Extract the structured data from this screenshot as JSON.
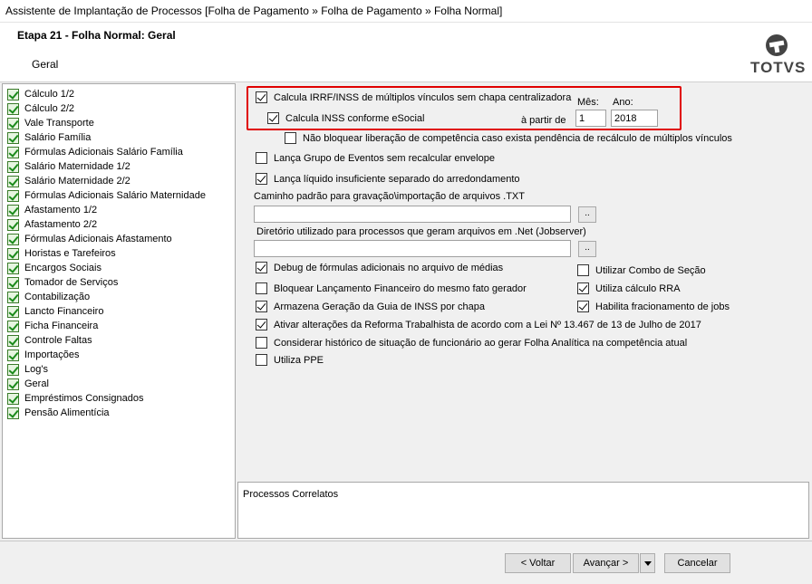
{
  "window": {
    "title": "Assistente de Implantação de Processos [Folha de Pagamento » Folha de Pagamento » Folha Normal]"
  },
  "header": {
    "step_title": "Etapa 21 - Folha Normal: Geral",
    "subtitle": "Geral",
    "logo_text": "TOTVS"
  },
  "sidebar": {
    "items": [
      {
        "label": "Cálculo 1/2"
      },
      {
        "label": "Cálculo 2/2"
      },
      {
        "label": "Vale Transporte"
      },
      {
        "label": "Salário Família"
      },
      {
        "label": "Fórmulas Adicionais Salário Família"
      },
      {
        "label": "Salário Maternidade 1/2"
      },
      {
        "label": "Salário Maternidade 2/2"
      },
      {
        "label": "Fórmulas Adicionais Salário Maternidade"
      },
      {
        "label": "Afastamento 1/2"
      },
      {
        "label": "Afastamento 2/2"
      },
      {
        "label": "Fórmulas Adicionais Afastamento"
      },
      {
        "label": "Horistas e Tarefeiros"
      },
      {
        "label": "Encargos Sociais"
      },
      {
        "label": "Tomador de Serviços"
      },
      {
        "label": "Contabilização"
      },
      {
        "label": "Lancto Financeiro"
      },
      {
        "label": "Ficha Financeira"
      },
      {
        "label": "Controle Faltas"
      },
      {
        "label": "Importações"
      },
      {
        "label": "Log's"
      },
      {
        "label": "Geral"
      },
      {
        "label": "Empréstimos Consignados"
      },
      {
        "label": "Pensão Alimentícia"
      }
    ]
  },
  "options": {
    "irrf_inss": {
      "label": "Calcula IRRF/INSS de múltiplos vínculos sem chapa centralizadora",
      "checked": true
    },
    "inss_esocial": {
      "label": "Calcula INSS conforme eSocial",
      "checked": true
    },
    "a_partir_de": "à partir de",
    "mes_label": "Mês:",
    "mes_value": "1",
    "ano_label": "Ano:",
    "ano_value": "2018",
    "nao_bloquear": {
      "label": "Não bloquear liberação de competência caso exista pendência de recálculo de múltiplos vínculos",
      "checked": false
    },
    "lanca_grupo": {
      "label": "Lança Grupo de Eventos sem recalcular envelope",
      "checked": false
    },
    "lanca_liquido": {
      "label": "Lança líquido insuficiente separado do arredondamento",
      "checked": true
    },
    "caminho_label": "Caminho padrão para gravação\\importação de arquivos .TXT",
    "caminho_value": "",
    "diretorio_label": "Diretório utilizado para processos que geram arquivos em .Net (Jobserver)",
    "diretorio_value": "",
    "browse_label": "..",
    "debug": {
      "label": "Debug de fórmulas adicionais no arquivo de médias",
      "checked": true
    },
    "bloquear_lanc": {
      "label": "Bloquear Lançamento Financeiro do mesmo fato gerador",
      "checked": false
    },
    "armazena": {
      "label": "Armazena Geração da Guia de INSS por chapa",
      "checked": true
    },
    "reforma": {
      "label": "Ativar alterações da Reforma Trabalhista de acordo com a Lei Nº 13.467 de 13 de Julho de 2017",
      "checked": true
    },
    "historico": {
      "label": "Considerar histórico de situação de funcionário ao gerar Folha Analítica na competência atual",
      "checked": false
    },
    "ppe": {
      "label": "Utiliza PPE",
      "checked": false
    },
    "combo_secao": {
      "label": "Utilizar Combo de Seção",
      "checked": false
    },
    "calculo_rra": {
      "label": "Utiliza cálculo RRA",
      "checked": true
    },
    "fracionamento": {
      "label": "Habilita fracionamento de jobs",
      "checked": true
    }
  },
  "correlatos": {
    "title": "Processos Correlatos"
  },
  "footer": {
    "back_label": "< Voltar",
    "next_label": "Avançar >",
    "cancel_label": "Cancelar"
  }
}
